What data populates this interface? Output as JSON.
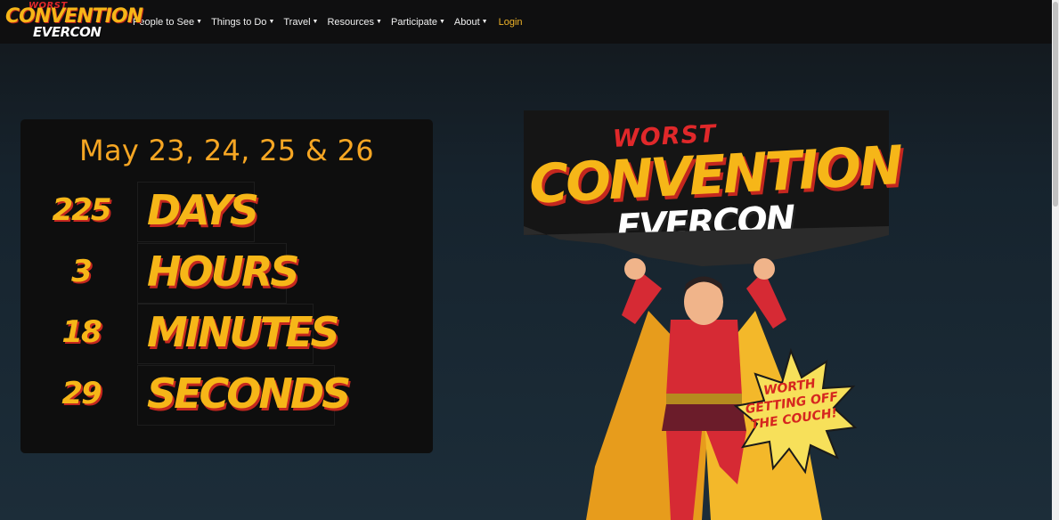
{
  "brand": {
    "logo_worst": "WORST",
    "logo_convention": "CONVENTION",
    "logo_evercon": "EVERCON"
  },
  "nav": {
    "items": [
      {
        "label": "People to See"
      },
      {
        "label": "Things to Do"
      },
      {
        "label": "Travel"
      },
      {
        "label": "Resources"
      },
      {
        "label": "Participate"
      },
      {
        "label": "About"
      }
    ],
    "login": "Login"
  },
  "countdown": {
    "dates": "May 23, 24, 25 & 26",
    "rows": [
      {
        "value": "225",
        "unit": "DAYS"
      },
      {
        "value": "3",
        "unit": "HOURS"
      },
      {
        "value": "18",
        "unit": "MINUTES"
      },
      {
        "value": "29",
        "unit": "SECONDS"
      }
    ]
  },
  "hero": {
    "worst": "WORST",
    "convention": "CONVENTION",
    "evercon": "EVERCON",
    "burst_line1": "WORTH",
    "burst_line2": "GETTING OFF",
    "burst_line3": "THE COUCH!"
  },
  "colors": {
    "accent_yellow": "#f6b618",
    "accent_red": "#c4271f",
    "date_orange": "#f6a623",
    "login_gold": "#f0b429"
  }
}
